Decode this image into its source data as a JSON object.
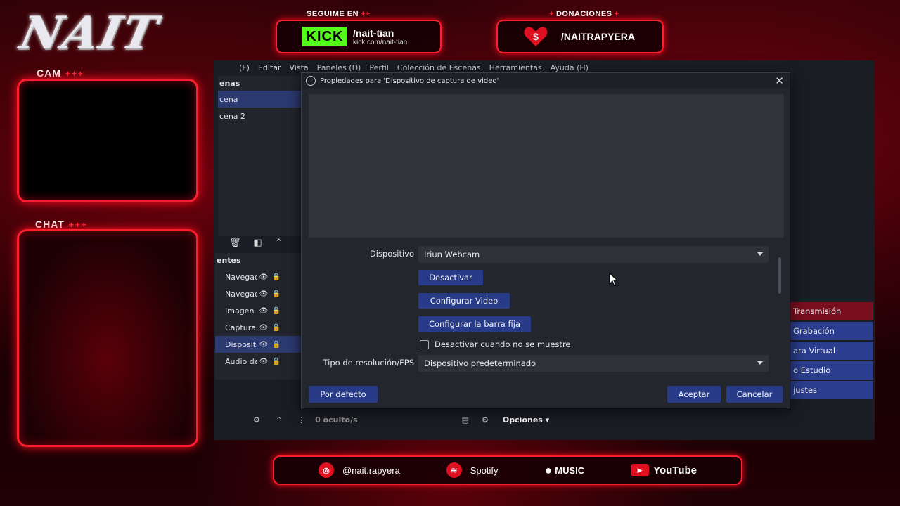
{
  "overlay": {
    "logo": "NAIT",
    "cam_label": "CAM",
    "chat_label": "CHAT",
    "plus_marks": "+++",
    "follow_label": "SEGUIME EN",
    "donations_label": "DONACIONES",
    "kick_logo": "KICK",
    "kick_handle": "/nait-tian",
    "kick_url": "kick.com/nait-tian",
    "donation_handle": "/NAITRAPYERA",
    "socials": [
      {
        "icon": "instagram-icon",
        "label": "@nait.rapyera"
      },
      {
        "icon": "spotify-icon",
        "label": "Spotify"
      },
      {
        "icon": "apple-icon",
        "label": "MUSIC"
      },
      {
        "icon": "youtube-icon",
        "label": "YouTube"
      }
    ],
    "colors": {
      "accent": "#ff1d2e",
      "kick": "#53fc18"
    }
  },
  "obs": {
    "menu": [
      "(F)",
      "Editar",
      "Vista",
      "Paneles (D)",
      "Perfil",
      "Colección de Escenas",
      "Herramientas",
      "Ayuda (H)"
    ],
    "scenes_header": "enas",
    "scenes": [
      "cena",
      "cena 2"
    ],
    "sources_header": "entes",
    "sources": [
      "Navegadc",
      "Navegadc",
      "Imagen",
      "Captura d",
      "Dispositiv",
      "Audio del"
    ],
    "controls": [
      "Transmisión",
      "Grabación",
      "ara Virtual",
      "o Estudio",
      "justes"
    ],
    "status": {
      "hidden": "0 oculto/s",
      "options": "Opciones"
    }
  },
  "dialog": {
    "title": "Propiedades para 'Dispositivo de captura de video'",
    "device_label": "Dispositivo",
    "device_value": "Iriun Webcam",
    "deactivate_button": "Desactivar",
    "configure_video_button": "Configurar Video",
    "configure_crossbar_button": "Configurar la barra fija",
    "deactivate_when_hidden": "Desactivar cuando no se muestre",
    "resolution_label": "Tipo de resolución/FPS",
    "resolution_value": "Dispositivo predeterminado",
    "defaults_button": "Por defecto",
    "accept_button": "Aceptar",
    "cancel_button": "Cancelar"
  }
}
